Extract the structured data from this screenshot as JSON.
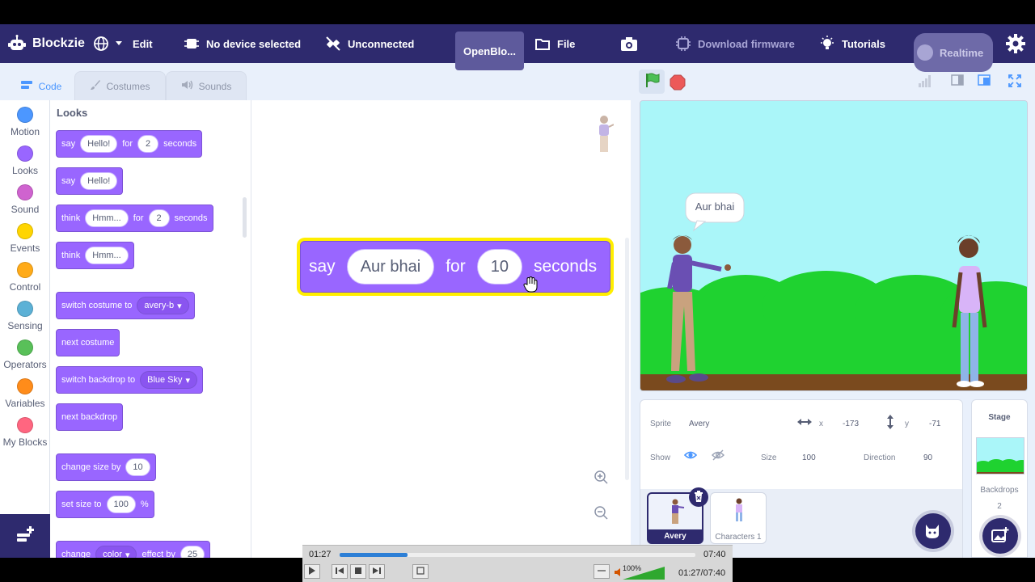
{
  "app": {
    "name": "Blockzie",
    "menu": {
      "language_icon": "globe-icon",
      "edit": "Edit",
      "device": "No device selected",
      "connection": "Unconnected",
      "project_title": "OpenBlo...",
      "file": "File",
      "download_firmware": "Download firmware",
      "tutorials": "Tutorials",
      "realtime": "Realtime"
    }
  },
  "tabs": [
    {
      "label": "Code",
      "icon": "code-icon"
    },
    {
      "label": "Costumes",
      "icon": "brush-icon"
    },
    {
      "label": "Sounds",
      "icon": "speaker-icon"
    }
  ],
  "categories": [
    {
      "label": "Motion",
      "color": "#4c97ff"
    },
    {
      "label": "Looks",
      "color": "#9966ff"
    },
    {
      "label": "Sound",
      "color": "#cf63cf"
    },
    {
      "label": "Events",
      "color": "#ffd500"
    },
    {
      "label": "Control",
      "color": "#ffab19"
    },
    {
      "label": "Sensing",
      "color": "#5cb1d6"
    },
    {
      "label": "Operators",
      "color": "#59c059"
    },
    {
      "label": "Variables",
      "color": "#ff8c1a"
    },
    {
      "label": "My Blocks",
      "color": "#ff6680"
    }
  ],
  "palette": {
    "title": "Looks",
    "blocks": {
      "say_for": {
        "t1": "say",
        "v1": "Hello!",
        "t2": "for",
        "v2": "2",
        "t3": "seconds"
      },
      "say": {
        "t1": "say",
        "v1": "Hello!"
      },
      "think_for": {
        "t1": "think",
        "v1": "Hmm...",
        "t2": "for",
        "v2": "2",
        "t3": "seconds"
      },
      "think": {
        "t1": "think",
        "v1": "Hmm..."
      },
      "switch_costume": {
        "t1": "switch costume to",
        "v1": "avery-b"
      },
      "next_costume": {
        "t1": "next costume"
      },
      "switch_backdrop": {
        "t1": "switch backdrop to",
        "v1": "Blue Sky"
      },
      "next_backdrop": {
        "t1": "next backdrop"
      },
      "change_size": {
        "t1": "change size by",
        "v1": "10"
      },
      "set_size": {
        "t1": "set size to",
        "v1": "100",
        "t2": "%"
      },
      "change_effect": {
        "t1": "change",
        "v1": "color",
        "t2": "effect by",
        "v2": "25"
      }
    }
  },
  "script": {
    "block": {
      "t1": "say",
      "v1": "Aur bhai",
      "t2": "for",
      "v2": "10",
      "t3": "seconds"
    }
  },
  "stage": {
    "speech": "Aur bhai"
  },
  "sprite_info": {
    "sprite_label": "Sprite",
    "sprite_name": "Avery",
    "x_label": "x",
    "x_value": "-173",
    "y_label": "y",
    "y_value": "-71",
    "show_label": "Show",
    "size_label": "Size",
    "size_value": "100",
    "direction_label": "Direction",
    "direction_value": "90",
    "sprites": [
      {
        "name": "Avery",
        "selected": true
      },
      {
        "name": "Characters 1",
        "selected": false
      }
    ]
  },
  "stage_panel": {
    "title": "Stage",
    "backdrops_label": "Backdrops",
    "backdrops_count": "2"
  },
  "player": {
    "current": "01:27",
    "total": "07:40",
    "progress": 0.19,
    "combined": "01:27/07:40",
    "volume": "100%"
  }
}
